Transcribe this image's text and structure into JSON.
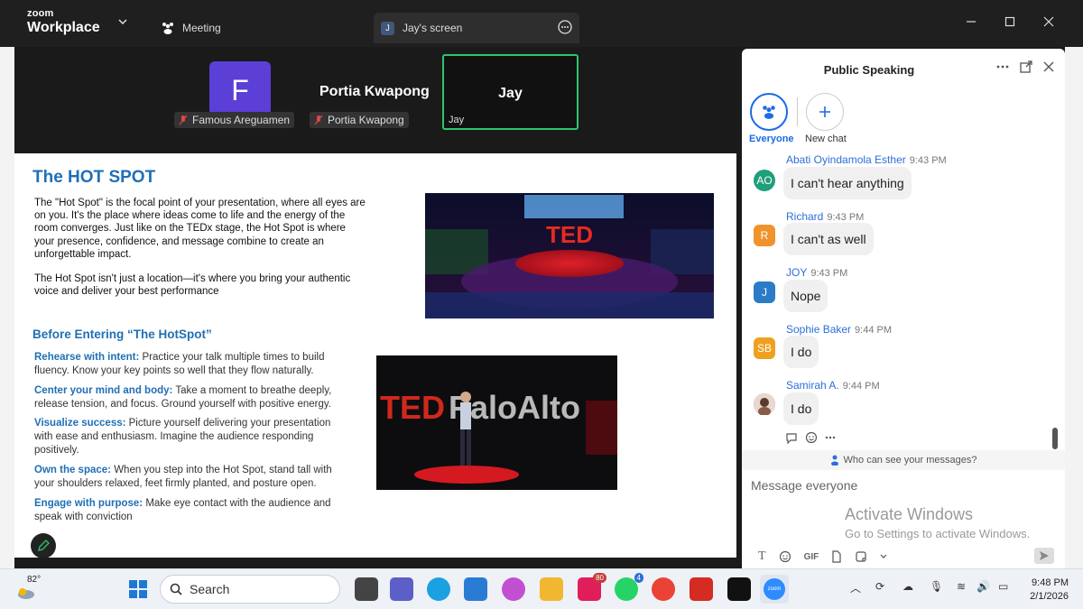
{
  "app": {
    "brand_line1": "zoom",
    "brand_line2": "Workplace"
  },
  "tabs": {
    "meeting_label": "Meeting",
    "screen_label": "Jay's screen",
    "screen_avatar": "J"
  },
  "participants": {
    "famous": {
      "initial": "F",
      "name": "Famous Areguamen"
    },
    "portia": {
      "display": "Portia Kwapong",
      "name": "Portia Kwapong"
    },
    "jay": {
      "display": "Jay",
      "name": "Jay"
    }
  },
  "slide": {
    "title": "The HOT SPOT",
    "para1": "The \"Hot Spot\" is the focal point of your presentation, where all eyes are on you. It's the place where ideas come to life and the energy of the room converges. Just like on the TEDx stage, the Hot Spot is where your presence, confidence, and message combine to create an unforgettable impact.",
    "para2": "The Hot Spot isn't just a location—it's where you bring your authentic voice and deliver your best performance",
    "section_title": "Before Entering “The HotSpot”",
    "items": [
      {
        "head": "Rehearse with intent:",
        "text": " Practice your talk multiple times to build fluency. Know your key points so well that they flow naturally."
      },
      {
        "head": "Center your mind and body:",
        "text": " Take a moment to breathe deeply, release tension, and focus. Ground yourself with positive energy."
      },
      {
        "head": "Visualize success:",
        "text": " Picture yourself delivering your presentation with ease and enthusiasm. Imagine the audience responding positively."
      },
      {
        "head": "Own the space:",
        "text": " When you step into the Hot Spot, stand tall with your shoulders relaxed, feet firmly planted, and posture open."
      },
      {
        "head": "Engage with purpose:",
        "text": " Make eye contact with the audience and speak with conviction"
      }
    ],
    "img1_text": "TED",
    "img2_text": "TEDxPaloAlto"
  },
  "chat": {
    "title": "Public Speaking",
    "tab_everyone": "Everyone",
    "tab_newchat": "New chat",
    "messages": [
      {
        "initials": "AO",
        "color": "#1f9f7a",
        "name": "Abati Oyindamola Esther",
        "time": "9:43 PM",
        "text": "I can't hear anything"
      },
      {
        "initials": "R",
        "color": "#f0932b",
        "name": "Richard",
        "time": "9:43 PM",
        "text": "I can't as well"
      },
      {
        "initials": "J",
        "color": "#2b7bc6",
        "name": "JOY",
        "time": "9:43 PM",
        "text": "Nope"
      },
      {
        "initials": "SB",
        "color": "#f0a020",
        "name": "Sophie Baker",
        "time": "9:44 PM",
        "text": "I do"
      },
      {
        "initials": "",
        "color": "#b07050",
        "name": "Samirah A.",
        "time": "9:44 PM",
        "text": "I do"
      }
    ],
    "who_can_see": "Who can see your messages?",
    "input_placeholder": "Message everyone",
    "gif_label": "GIF"
  },
  "watermark": {
    "line1": "Activate Windows",
    "line2": "Go to Settings to activate Windows."
  },
  "taskbar": {
    "temperature": "82°",
    "search_placeholder": "Search",
    "slack_badge": "80",
    "whatsapp_badge": "4",
    "zoom_label": "zoom",
    "time": "9:48 PM",
    "date": "2/1/2026"
  }
}
